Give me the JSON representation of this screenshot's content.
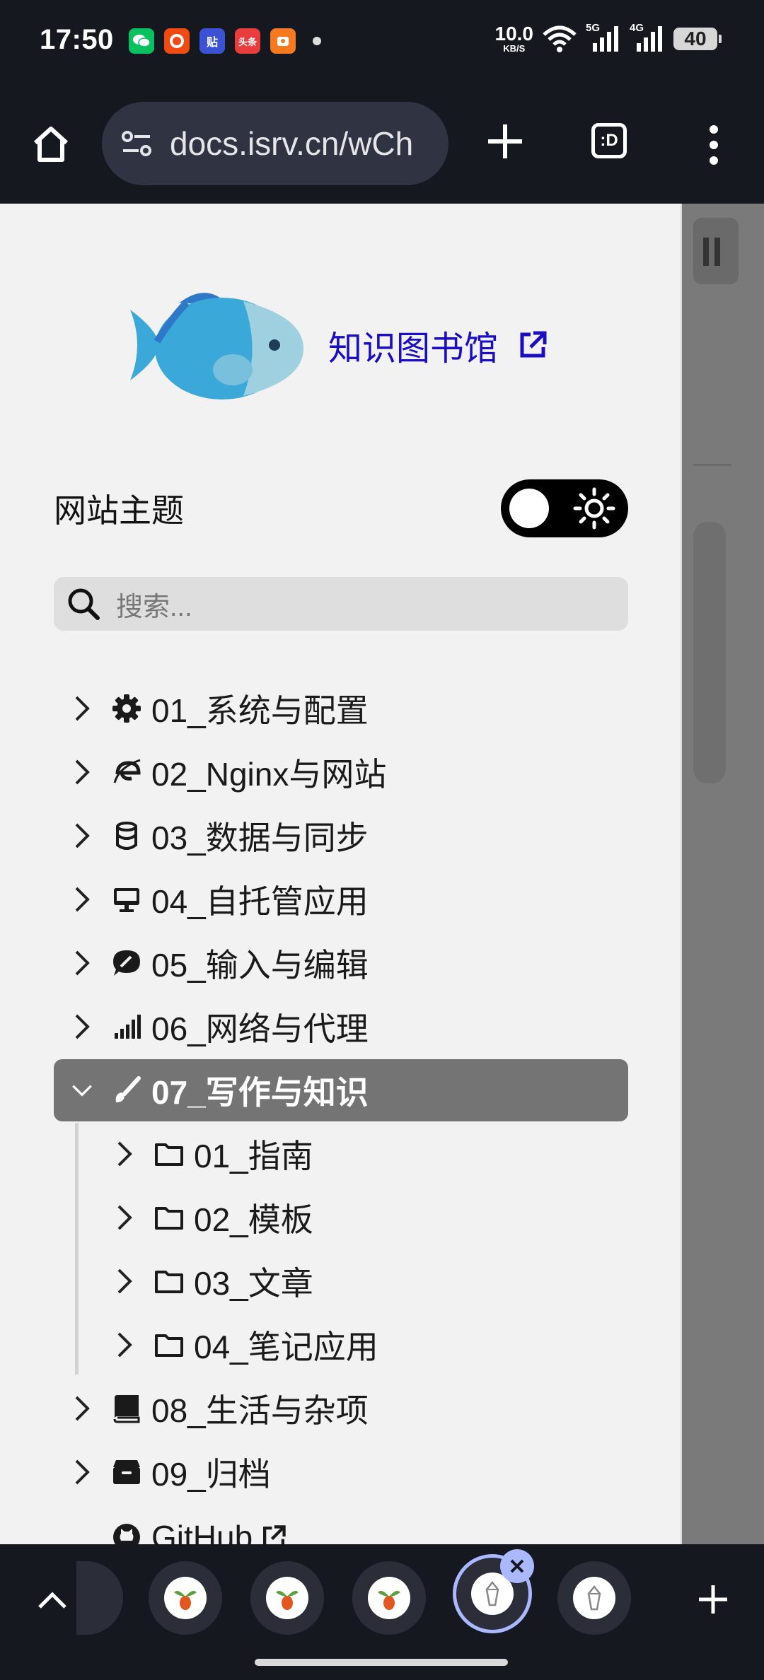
{
  "status_bar": {
    "time": "17:50",
    "notification_apps": [
      {
        "name": "wechat-icon",
        "label": "",
        "color": "#07c160"
      },
      {
        "name": "app-icon",
        "label": "",
        "color": "#f24b12"
      },
      {
        "name": "tieba-icon",
        "label": "贴",
        "color": "#3b52d4"
      },
      {
        "name": "toutiao-icon",
        "label": "头条",
        "color": "#e93c3c"
      },
      {
        "name": "app-icon",
        "label": "",
        "color": "#f7791f"
      }
    ],
    "net_speed": "10.0",
    "net_speed_unit": "KB/S",
    "signal_1": "5G",
    "signal_2": "4G",
    "battery": "40"
  },
  "browser": {
    "url": "docs.isrv.cn/wCh",
    "tab_switcher_label": ":D"
  },
  "sidebar": {
    "site_title": "知识图书馆",
    "theme_label": "网站主题",
    "search_placeholder": "搜索...",
    "items": [
      {
        "label": "01_系统与配置",
        "icon": "gear-icon"
      },
      {
        "label": "02_Nginx与网站",
        "icon": "internet-explorer-icon"
      },
      {
        "label": "03_数据与同步",
        "icon": "database-icon"
      },
      {
        "label": "04_自托管应用",
        "icon": "desktop-icon"
      },
      {
        "label": "05_输入与编辑",
        "icon": "comment-pen-icon"
      },
      {
        "label": "06_网络与代理",
        "icon": "signal-icon"
      },
      {
        "label": "07_写作与知识",
        "icon": "paintbrush-icon",
        "expanded": true
      },
      {
        "label": "08_生活与杂项",
        "icon": "book-icon"
      },
      {
        "label": "09_归档",
        "icon": "archive-icon"
      },
      {
        "label": "GitHub",
        "icon": "github-icon"
      }
    ],
    "children": [
      {
        "label": "01_指南",
        "icon": "folder-icon"
      },
      {
        "label": "02_模板",
        "icon": "folder-icon"
      },
      {
        "label": "03_文章",
        "icon": "folder-icon"
      },
      {
        "label": "04_笔记应用",
        "icon": "folder-icon"
      }
    ]
  },
  "colors": {
    "title_link": "#1a0dc4",
    "active_item_bg": "#747474",
    "selected_tab_ring": "#a9b8ff"
  }
}
